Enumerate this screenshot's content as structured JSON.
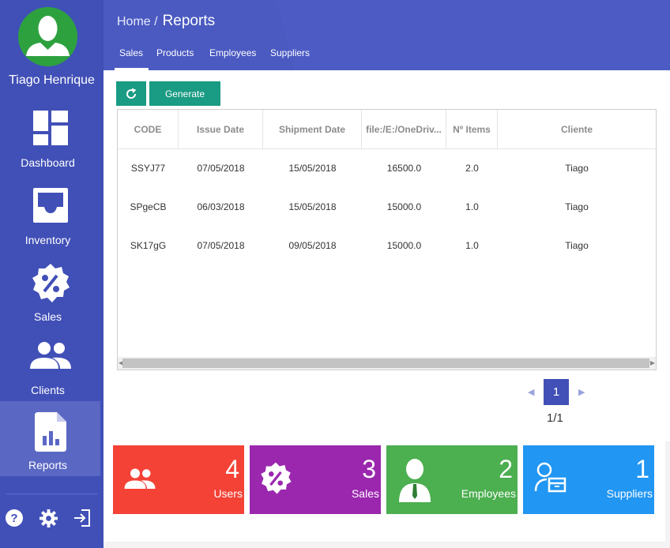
{
  "user": {
    "name": "Tiago Henrique"
  },
  "sidebar": {
    "items": [
      {
        "label": "Dashboard",
        "icon": "dashboard-icon"
      },
      {
        "label": "Inventory",
        "icon": "inbox-icon"
      },
      {
        "label": "Sales",
        "icon": "discount-badge-icon"
      },
      {
        "label": "Clients",
        "icon": "group-icon"
      },
      {
        "label": "Reports",
        "icon": "report-chart-icon",
        "active": true
      }
    ],
    "bottom_icons": [
      "help-icon",
      "gear-icon",
      "logout-icon"
    ]
  },
  "header": {
    "breadcrumb_home": "Home /",
    "breadcrumb_current": "Reports",
    "tabs": [
      "Sales",
      "Products",
      "Employees",
      "Suppliers"
    ],
    "active_tab": "Sales"
  },
  "toolbar": {
    "generate_label": "Generate"
  },
  "table": {
    "columns": [
      "CODE",
      "Issue Date",
      "Shipment Date",
      "file:/E:/OneDriv...",
      "Nº Items",
      "Cliente"
    ],
    "rows": [
      [
        "SSYJ77",
        "07/05/2018",
        "15/05/2018",
        "16500.0",
        "2.0",
        "Tiago"
      ],
      [
        "SPgeCB",
        "06/03/2018",
        "15/05/2018",
        "15000.0",
        "1.0",
        "Tiago"
      ],
      [
        "SK17gG",
        "07/05/2018",
        "09/05/2018",
        "15000.0",
        "1.0",
        "Tiago"
      ]
    ]
  },
  "pagination": {
    "current": "1",
    "info": "1/1"
  },
  "cards": [
    {
      "value": "4",
      "label": "Users",
      "color": "#f44236",
      "icon": "group-icon"
    },
    {
      "value": "3",
      "label": "Sales",
      "color": "#9b27af",
      "icon": "discount-badge-icon"
    },
    {
      "value": "2",
      "label": "Employees",
      "color": "#4caf50",
      "icon": "employee-icon"
    },
    {
      "value": "1",
      "label": "Suppliers",
      "color": "#2196f3",
      "icon": "supplier-icon"
    }
  ]
}
